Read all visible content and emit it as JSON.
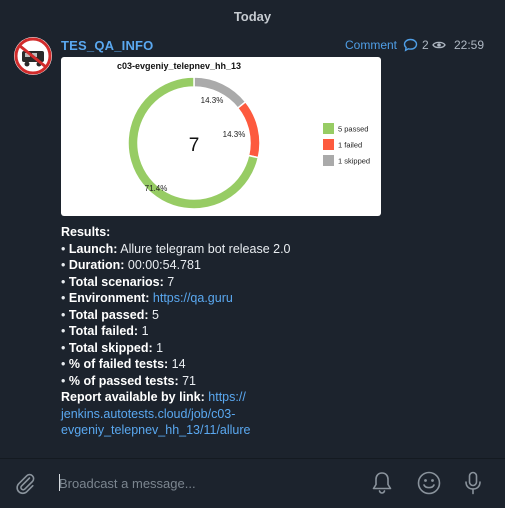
{
  "date_separator": "Today",
  "message": {
    "channel_name": "TES_QA_INFO",
    "comment_label": "Comment",
    "views": "2",
    "time": "22:59"
  },
  "chart_data": {
    "type": "pie",
    "title": "c03-evgeniy_telepnev_hh_13",
    "center_label": "7",
    "slices": [
      {
        "label": "5 passed",
        "value": 5,
        "percent_label": "71.4%",
        "color": "#97cc64"
      },
      {
        "label": "1 failed",
        "value": 1,
        "percent_label": "14.3%",
        "color": "#fd5a3e"
      },
      {
        "label": "1 skipped",
        "value": 1,
        "percent_label": "14.3%",
        "color": "#aaaaaa"
      }
    ],
    "legend_position": "right"
  },
  "results": {
    "heading": "Results:",
    "launch_label": "Launch:",
    "launch_value": "Allure telegram bot release 2.0",
    "duration_label": "Duration:",
    "duration_value": "00:00:54.781",
    "scenarios_label": "Total scenarios:",
    "scenarios_value": "7",
    "environment_label": "Environment:",
    "environment_value": "https://qa.guru",
    "passed_label": "Total passed:",
    "passed_value": "5",
    "failed_label": "Total failed:",
    "failed_value": "1",
    "skipped_label": "Total skipped:",
    "skipped_value": "1",
    "failed_pct_label": "% of failed tests:",
    "failed_pct_value": "14",
    "passed_pct_label": "% of passed tests:",
    "passed_pct_value": "71",
    "report_label": "Report available by link:",
    "report_link_1": "https://",
    "report_link_2": "jenkins.autotests.cloud/job/c03-",
    "report_link_3": "evgeniy_telepnev_hh_13/11/allure"
  },
  "composer": {
    "placeholder": "Broadcast a message..."
  },
  "icons": {
    "attach": "paperclip-icon",
    "bell": "bell-icon",
    "emoji": "smile-icon",
    "mic": "microphone-icon",
    "comment": "comment-bubble-icon",
    "views": "eye-icon"
  }
}
